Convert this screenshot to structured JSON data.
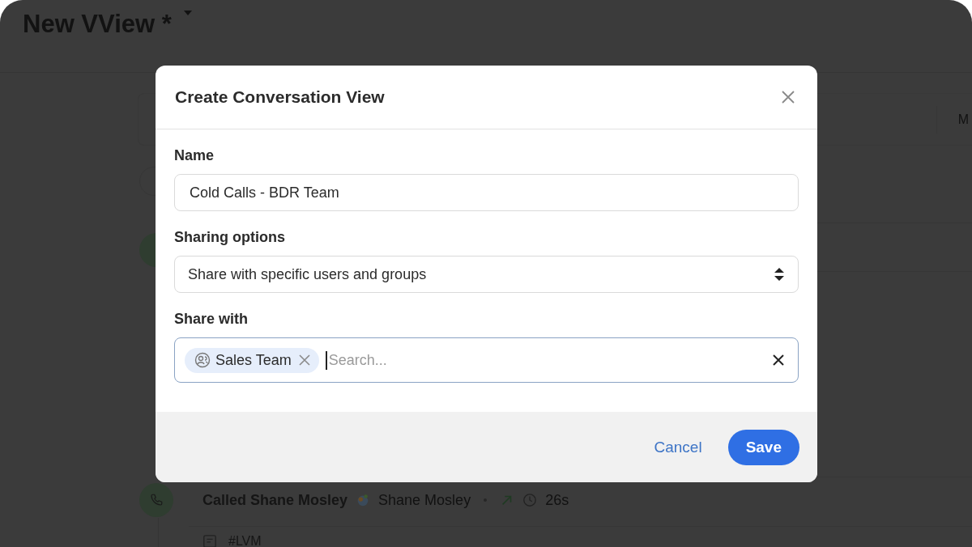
{
  "page": {
    "title": "New VView *",
    "toolbar_label": "M"
  },
  "timeline": [
    {
      "kind": "call",
      "title": "Called Shane Mosley",
      "contact": "Shane Mosley",
      "duration": "26s"
    }
  ],
  "note": {
    "label": "#LVM"
  },
  "dialog": {
    "title": "Create Conversation View",
    "fields": [
      {
        "kind": "text",
        "label": "Name",
        "value": "Cold Calls - BDR Team"
      },
      {
        "kind": "select",
        "label": "Sharing options",
        "value": "Share with specific users and groups"
      },
      {
        "kind": "chips",
        "label": "Share with",
        "chips": [
          "Sales Team"
        ],
        "placeholder": "Search..."
      }
    ],
    "cancel": "Cancel",
    "save": "Save"
  }
}
